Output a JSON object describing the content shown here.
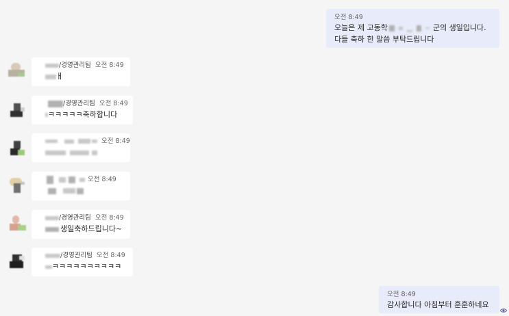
{
  "messages_out": [
    {
      "time": "오전 8:49",
      "line1_prefix": "오늘은 제 고동학",
      "line1_suffix": "군의 생일입니다.",
      "line2": "다들 축하 한 말씀 부탁드립니다"
    },
    {
      "time": "오전 8:49",
      "line1": "감사합니다 아침부터 훈훈하네요"
    }
  ],
  "messages_in": [
    {
      "sender_team": "/경영관리팀",
      "time": "오전 8:49",
      "text": "ㅐ"
    },
    {
      "sender_team": "/경영관리팀",
      "time": "오전 8:49",
      "text": "ㅋㅋㅋㅋㅋ축하합니다"
    },
    {
      "sender_team": "",
      "time": "오전 8:49",
      "text": ""
    },
    {
      "sender_team": "",
      "time": "오전 8:49",
      "text": ""
    },
    {
      "sender_team": "/경영관리팀",
      "time": "오전 8:49",
      "text": "생일축하드립니다~"
    },
    {
      "sender_team": "/경영관리팀",
      "time": "오전 8:49",
      "text": "ㅋㅋㅋㅋㅋㅋㅋㅋㅋㅋ"
    }
  ],
  "icons": {
    "read_receipt": "eye-icon"
  }
}
